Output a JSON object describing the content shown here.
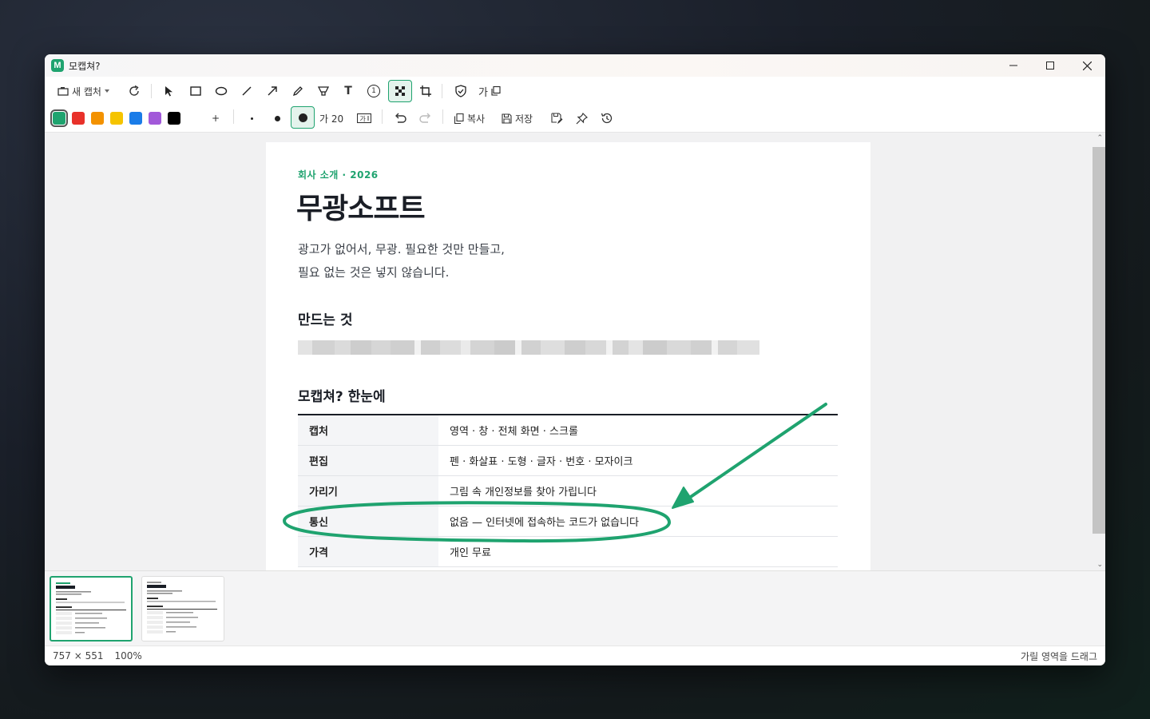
{
  "window": {
    "title": "모캡쳐?",
    "app_icon_letter": "M"
  },
  "toolbar": {
    "new_capture_label": "새 캡처",
    "text_tool_glyph": "T",
    "number_tool_glyph": "1",
    "font_tool_label": "가",
    "font_size_label": "가 20",
    "copy_label": "복사",
    "save_label": "저장",
    "add_swatch_glyph": "+",
    "colors": [
      "#1fa36f",
      "#e8312a",
      "#f39200",
      "#f5c400",
      "#1a7ce8",
      "#a259d9",
      "#000000"
    ],
    "selected_color": "#1fa36f"
  },
  "document": {
    "eyebrow": "회사 소개 · 2026",
    "title": "무광소프트",
    "lede_line1": "광고가 없어서, 무광. 필요한 것만 만들고,",
    "lede_line2": "필요 없는 것은 넣지 않습니다.",
    "section1_heading": "만드는 것",
    "section2_heading": "모캡쳐? 한눈에",
    "table": [
      {
        "key": "캡처",
        "value": "영역 · 창 · 전체 화면 · 스크롤"
      },
      {
        "key": "편집",
        "value": "펜 · 화살표 · 도형 · 글자 · 번호 · 모자이크"
      },
      {
        "key": "가리기",
        "value": "그림 속 개인정보를 찾아 가립니다"
      },
      {
        "key": "통신",
        "value": "없음 — 인터넷에 접속하는 코드가 없습니다"
      },
      {
        "key": "가격",
        "value": "개인 무료"
      }
    ]
  },
  "annotation": {
    "color": "#1fa36f"
  },
  "status": {
    "dimensions": "757 × 551",
    "zoom": "100%",
    "hint": "가릴 영역을 드래그"
  }
}
